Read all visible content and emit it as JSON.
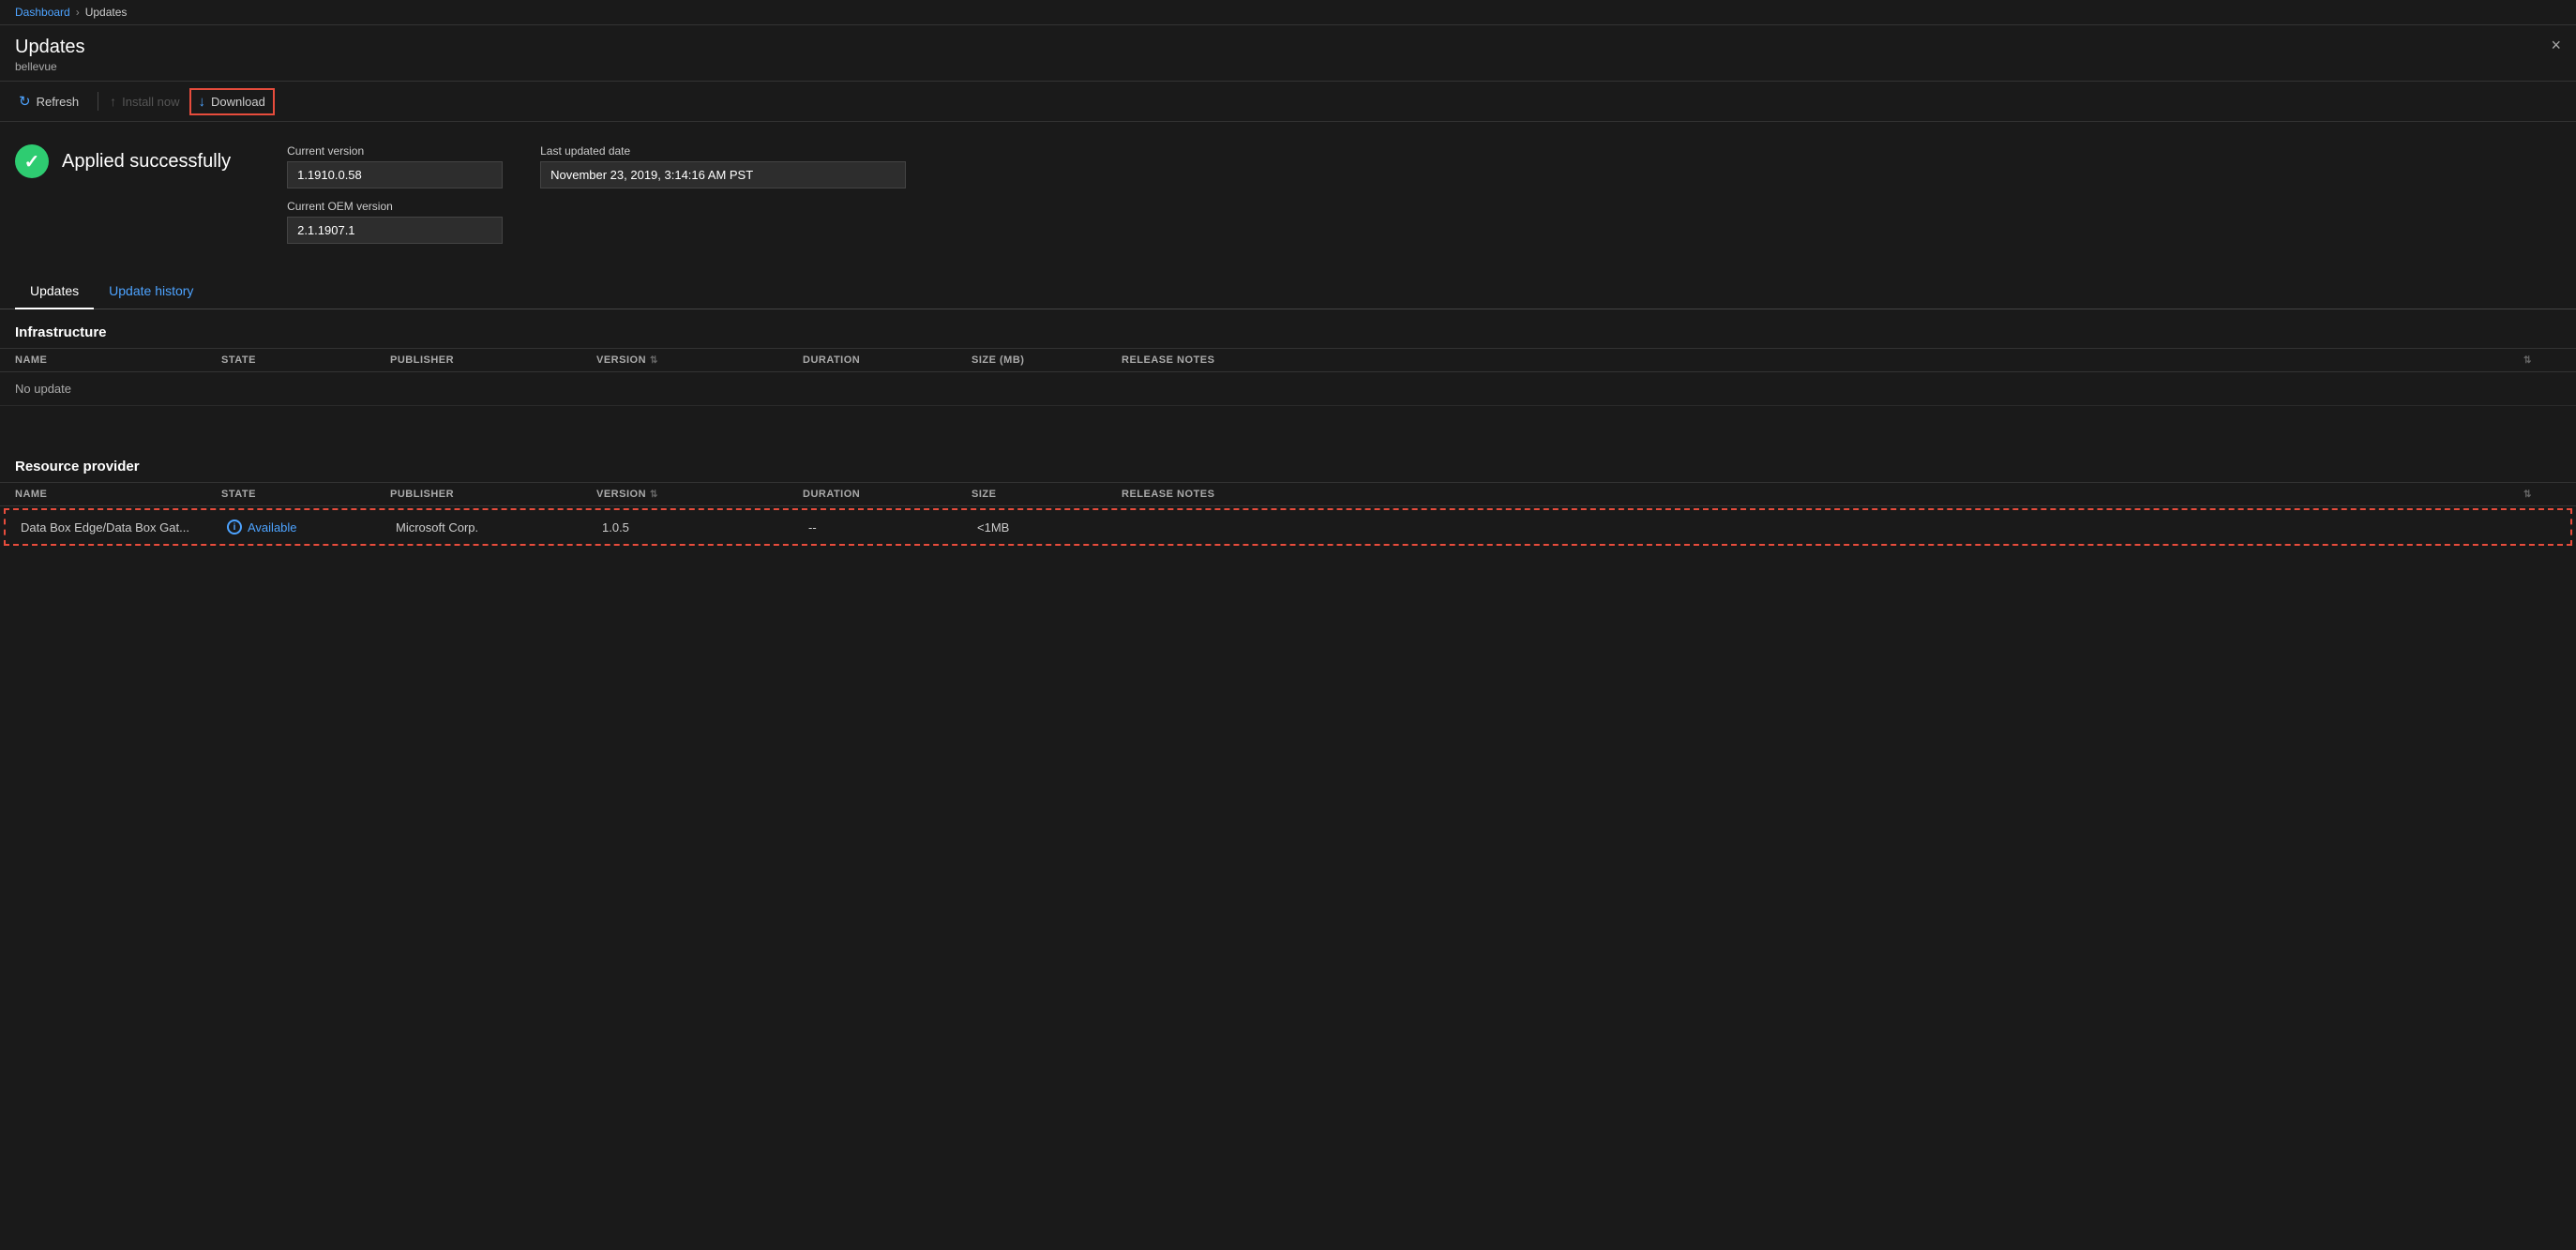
{
  "breadcrumb": {
    "parent": "Dashboard",
    "current": "Updates"
  },
  "header": {
    "title": "Updates",
    "subtitle": "bellevue",
    "close_label": "×"
  },
  "toolbar": {
    "refresh_label": "Refresh",
    "install_label": "Install now",
    "download_label": "Download"
  },
  "status": {
    "text": "Applied successfully"
  },
  "current_version": {
    "label": "Current version",
    "value": "1.1910.0.58"
  },
  "current_oem_version": {
    "label": "Current OEM version",
    "value": "2.1.1907.1"
  },
  "last_updated_date": {
    "label": "Last updated date",
    "value": "November 23, 2019, 3:14:16 AM PST"
  },
  "tabs": [
    {
      "id": "updates",
      "label": "Updates",
      "active": true
    },
    {
      "id": "update-history",
      "label": "Update history",
      "active": false
    }
  ],
  "infrastructure": {
    "section_title": "Infrastructure",
    "columns": [
      "NAME",
      "STATE",
      "PUBLISHER",
      "VERSION",
      "DURATION",
      "SIZE (MB)",
      "RELEASE NOTES"
    ],
    "no_data": "No update"
  },
  "resource_provider": {
    "section_title": "Resource provider",
    "columns": [
      "NAME",
      "STATE",
      "PUBLISHER",
      "VERSION",
      "DURATION",
      "SIZE",
      "RELEASE NOTES"
    ],
    "rows": [
      {
        "name": "Data Box Edge/Data Box Gat...",
        "state": "Available",
        "publisher": "Microsoft Corp.",
        "version": "1.0.5",
        "duration": "--",
        "size": "<1MB",
        "release_notes": ""
      }
    ]
  }
}
